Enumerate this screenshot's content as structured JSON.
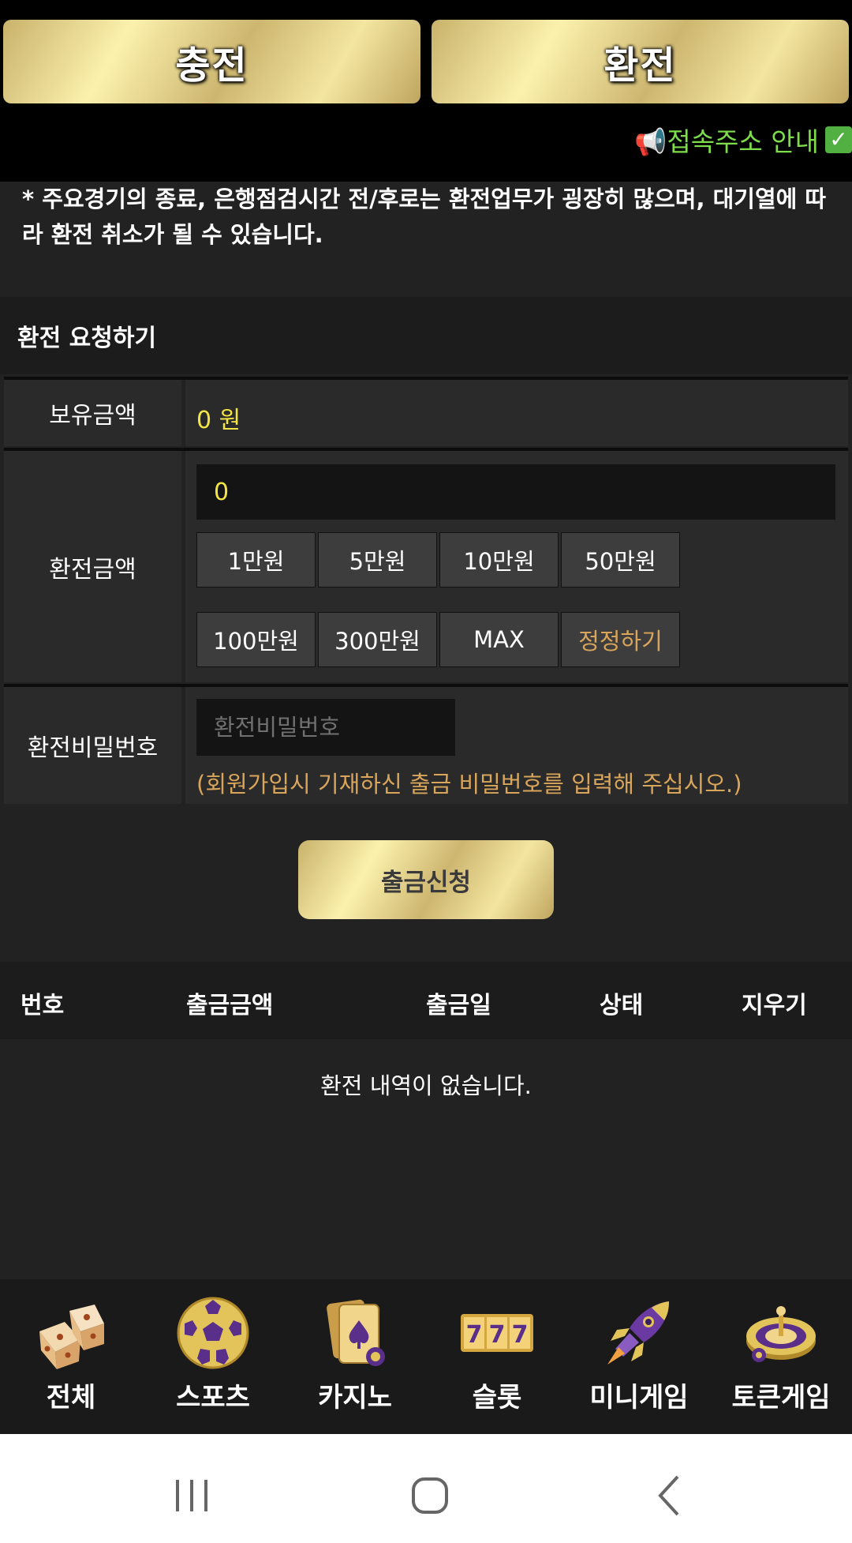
{
  "header": {
    "charge_label": "충전",
    "exchange_label": "환전",
    "notice_link": "📢접속주소 안내"
  },
  "warning_text": "* 주요경기의 종료, 은행점검시간 전/후로는 환전업무가 굉장히 많으며, 대기열에 따라 환전 취소가 될 수 있습니다.",
  "form": {
    "title": "환전 요청하기",
    "balance_label": "보유금액",
    "balance_value": "0 원",
    "amount_label": "환전금액",
    "amount_value": "0",
    "amount_buttons": [
      "1만원",
      "5만원",
      "10만원",
      "50만원",
      "100만원",
      "300만원",
      "MAX",
      "정정하기"
    ],
    "password_label": "환전비밀번호",
    "password_placeholder": "환전비밀번호",
    "password_hint": "(회원가입시 기재하신 출금 비밀번호를 입력해 주십시오.)",
    "submit_label": "출금신청"
  },
  "history": {
    "columns": [
      "번호",
      "출금금액",
      "출금일",
      "상태",
      "지우기"
    ],
    "empty_message": "환전 내역이 없습니다."
  },
  "bottom_nav": [
    {
      "label": "전체",
      "icon": "dice-icon"
    },
    {
      "label": "스포츠",
      "icon": "soccer-ball-icon"
    },
    {
      "label": "카지노",
      "icon": "playing-cards-icon"
    },
    {
      "label": "슬롯",
      "icon": "slot-777-icon"
    },
    {
      "label": "미니게임",
      "icon": "rocket-icon"
    },
    {
      "label": "토큰게임",
      "icon": "roulette-icon"
    }
  ],
  "colors": {
    "accent_gold": "#e8d78a",
    "value_yellow": "#f3e544",
    "hint_orange": "#d9a55a",
    "notice_green": "#7ddd4b"
  }
}
